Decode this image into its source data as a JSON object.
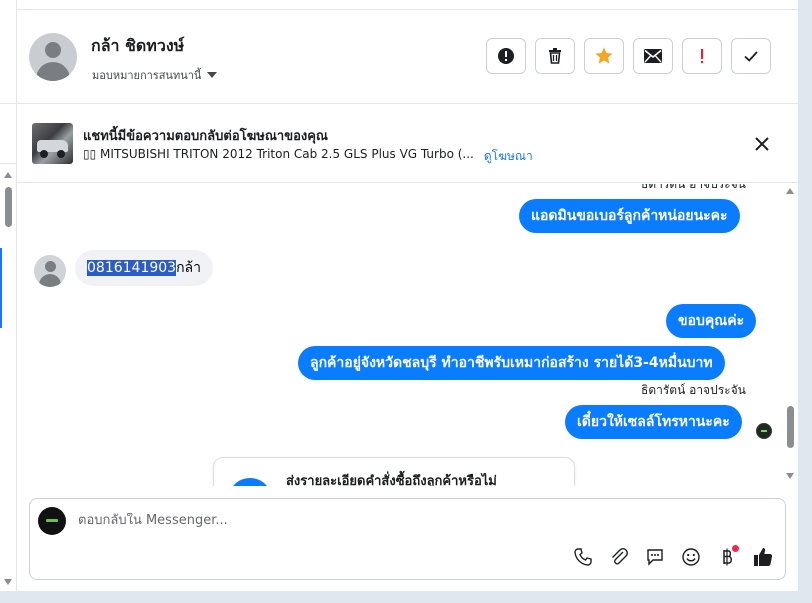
{
  "header": {
    "contact_name": "กล้า ชิดทวงษ์",
    "assign_label": "มอบหมายการสนทนานี้",
    "actions": [
      {
        "name": "report-icon",
        "label": "!"
      },
      {
        "name": "trash-icon",
        "label": ""
      },
      {
        "name": "star-icon",
        "label": ""
      },
      {
        "name": "mail-icon",
        "label": ""
      },
      {
        "name": "spam-icon",
        "label": "!"
      },
      {
        "name": "check-icon",
        "label": ""
      }
    ]
  },
  "ad_banner": {
    "title": "แชทนี้มีข้อความตอบกลับต่อโฆษณาของคุณ",
    "ad_name": "󠀠󠀠MITSUBISHI TRITON 2012 Triton Cab 2.5 GLS Plus VG Turbo (...",
    "ad_name_prefix": "▯▯",
    "ad_name_text": "MITSUBISHI TRITON 2012 Triton Cab 2.5 GLS Plus VG Turbo (...",
    "view_ad_link": "ดูโฆษณา"
  },
  "messages": {
    "top_sender_partial": "ธิดารัตน์ อาจประจัน",
    "out_1": "แอดมินขอเบอร์ลูกค้าหน่อยนะคะ",
    "in_1_selected": "0816141903",
    "in_1_rest": "กล้า",
    "out_2": "ขอบคุณค่ะ",
    "out_3": "ลูกค้าอยู่จังหวัดชลบุรี ทำอาชีพรับเหมาก่อสร้าง รายได้3-4หมื่นบาท",
    "sender_2": "ธิดารัตน์ อาจประจัน",
    "out_4": "เดี๋ยวให้เซลล์โทรหานะคะ",
    "card_text": "ส่งรายละเอียดคำสั่งซื้อถึงลูกค้าหรือไม่"
  },
  "composer": {
    "placeholder": "ตอบกลับใน Messenger...",
    "tools": [
      "phone-icon",
      "attachment-icon",
      "comment-icon",
      "emoji-icon",
      "payment-icon",
      "like-icon"
    ]
  },
  "colors": {
    "accent": "#0a7cff",
    "star": "#f5a623",
    "danger": "#e41e3f",
    "link": "#1877f2"
  }
}
